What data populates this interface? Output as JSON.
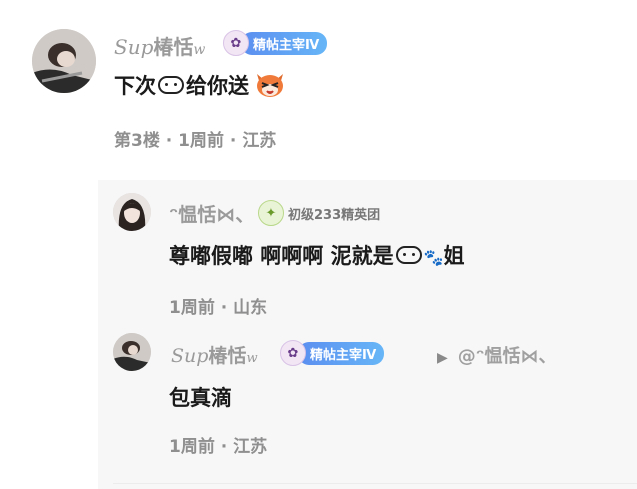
{
  "comment": {
    "user_prefix": "Sup",
    "user_name": "椿恬",
    "user_suffix": "w",
    "badge_label": "精帖主宰Ⅳ",
    "content_text_1": "下次",
    "content_text_2": "给你送",
    "meta_floor": "第3楼",
    "meta_time": "1周前",
    "meta_location": "江苏"
  },
  "reply1": {
    "user_name": "ᵔ愠恬⋈、",
    "badge_label": "初级233精英团",
    "content_text_1": "尊嘟假嘟 啊啊啊 泥就是",
    "content_text_2": "姐",
    "meta_time": "1周前",
    "meta_location": "山东"
  },
  "reply2": {
    "user_prefix": "Sup",
    "user_name": "椿恬",
    "user_suffix": "w",
    "badge_label": "精帖主宰Ⅳ",
    "reply_to": "@ᵔ愠恬⋈、",
    "content_text": "包真滴",
    "meta_time": "1周前",
    "meta_location": "江苏"
  },
  "separator": "·",
  "colors": {
    "badge_gradient_start": "#5b8ef0",
    "badge_gradient_end": "#67b6f7",
    "meta_gray": "#8f8f8f",
    "username_gray": "#9a9a9a",
    "reply_panel_bg": "#f7f7f8"
  },
  "icons": {
    "badge": "anime-girl-badge-icon",
    "green_badge": "leaf-badge-icon",
    "sticker": "fox-face-sticker",
    "reply_arrow": "play-triangle-icon"
  }
}
